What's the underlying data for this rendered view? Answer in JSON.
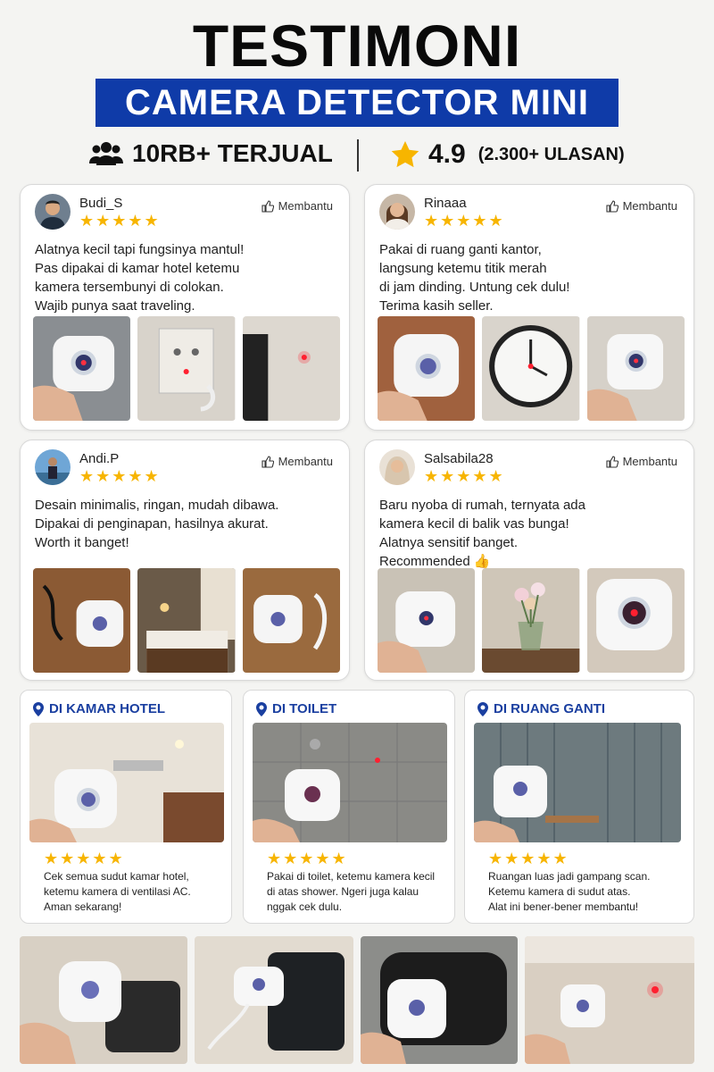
{
  "header": {
    "title": "TESTIMONI",
    "subtitle": "CAMERA DETECTOR MINI",
    "sold": "10RB+ TERJUAL",
    "rating": "4.9",
    "reviews": "(2.300+ ULASAN)"
  },
  "colors": {
    "brand": "#0f3ba8",
    "star": "#f7b500",
    "loc": "#1a3fa0"
  },
  "reviews": [
    {
      "name": "Budi_S",
      "stars": "★★★★★",
      "helpful": "Membantu",
      "text": "Alatnya kecil tapi fungsinya mantul!\nPas dipakai di kamar hotel ketemu\nkamera tersembunyi di colokan.\nWajib punya saat traveling."
    },
    {
      "name": "Rinaaa",
      "stars": "★★★★★",
      "helpful": "Membantu",
      "text": "Pakai di ruang ganti kantor,\nlangsung ketemu titik merah\ndi jam dinding. Untung cek dulu!\nTerima kasih seller."
    },
    {
      "name": "Andi.P",
      "stars": "★★★★★",
      "helpful": "Membantu",
      "text": "Desain minimalis, ringan, mudah dibawa.\nDipakai di penginapan, hasilnya akurat.\nWorth it banget!"
    },
    {
      "name": "Salsabila28",
      "stars": "★★★★★",
      "helpful": "Membantu",
      "text": "Baru nyoba di rumah, ternyata ada\nkamera kecil di balik vas bunga!\nAlatnya sensitif banget.\nRecommended 👍"
    }
  ],
  "locations": [
    {
      "title": "DI KAMAR HOTEL",
      "stars": "★★★★★",
      "text": "Cek semua sudut kamar hotel,\nketemu kamera di ventilasi AC.\nAman sekarang!"
    },
    {
      "title": "DI TOILET",
      "stars": "★★★★★",
      "text": "Pakai di toilet, ketemu kamera kecil\ndi atas shower. Ngeri juga kalau\nnggak cek dulu."
    },
    {
      "title": "DI RUANG GANTI",
      "stars": "★★★★★",
      "text": "Ruangan luas jadi gampang scan.\nKetemu kamera di sudut atas.\nAlat ini bener-bener membantu!"
    }
  ],
  "icons": [
    "users-icon",
    "star-icon",
    "thumbs-up-icon",
    "location-pin-icon"
  ]
}
